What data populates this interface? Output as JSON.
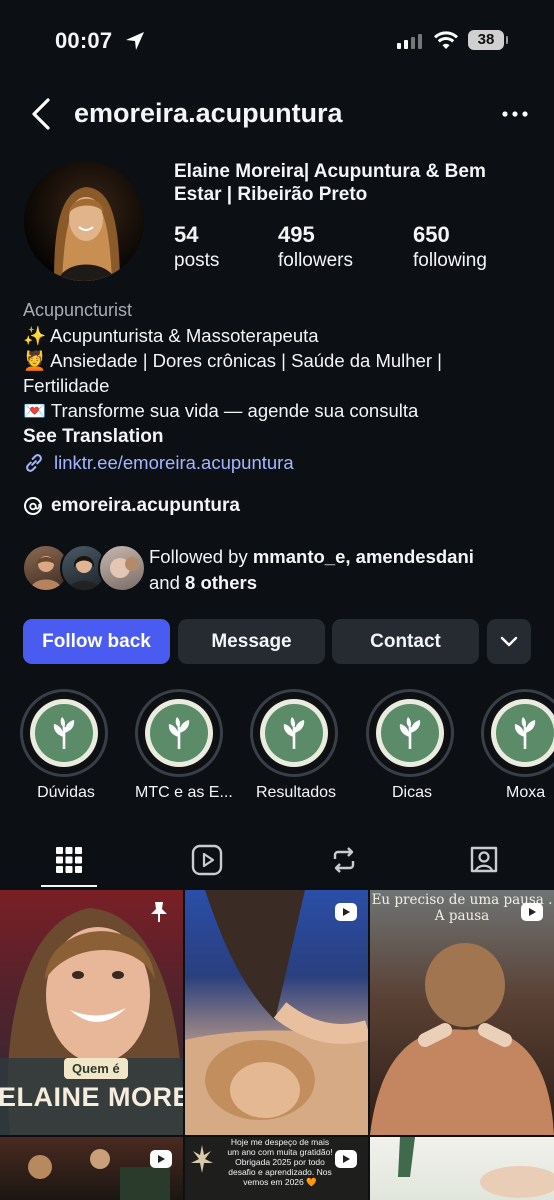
{
  "status_bar": {
    "time": "00:07",
    "battery": "38"
  },
  "header": {
    "username": "emoreira.acupuntura"
  },
  "profile": {
    "display_name": "Elaine Moreira| Acupuntura &  Bem\nEstar  | Ribeirão Preto",
    "stats": [
      {
        "value": "54",
        "label": "posts"
      },
      {
        "value": "495",
        "label": "followers"
      },
      {
        "value": "650",
        "label": "following"
      }
    ],
    "category": "Acupuncturist",
    "bio_lines": [
      "✨ Acupunturista & Massoterapeuta",
      "💆 Ansiedade | Dores crônicas | Saúde da Mulher |",
      "Fertilidade",
      "💌 Transforme sua vida — agende sua consulta"
    ],
    "see_translation": "See Translation",
    "link": "linktr.ee/emoreira.acupuntura",
    "threads_handle": "emoreira.acupuntura",
    "followed_by": {
      "prefix": "Followed by ",
      "names": "mmanto_e, amendesdani",
      "and": "and ",
      "others": "8 others"
    }
  },
  "actions": {
    "follow_back": "Follow back",
    "message": "Message",
    "contact": "Contact"
  },
  "highlights": [
    {
      "label": "Dúvidas"
    },
    {
      "label": "MTC e as E..."
    },
    {
      "label": "Resultados"
    },
    {
      "label": "Dicas"
    },
    {
      "label": "Moxa"
    }
  ],
  "grid": {
    "post1": {
      "badge": "Quem é",
      "banner": "ELAINE MOREIR"
    },
    "post3": {
      "line1": "Eu preciso de uma pausa .",
      "line2": "A pausa"
    },
    "post5": {
      "text": "Hoje me despeço de mais um ano com muita gratidão! Obrigada 2025 por todo desafio e aprendizado. Nos vemos em 2026 🧡"
    }
  },
  "colors": {
    "background": "#0c0f14",
    "accent": "#4a5bf2",
    "link": "#a3b6ff",
    "secondary_button": "#262a31"
  }
}
